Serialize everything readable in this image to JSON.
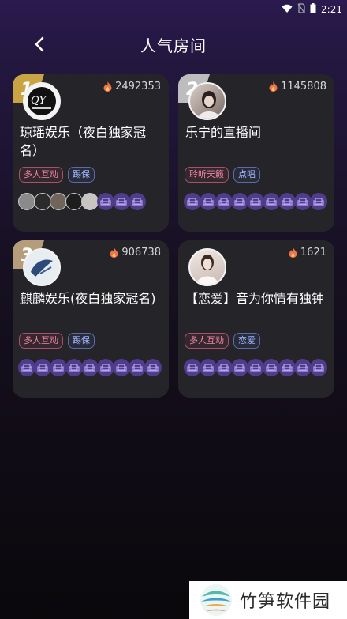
{
  "status_bar": {
    "time": "2:21"
  },
  "header": {
    "title": "人气房间"
  },
  "rooms": [
    {
      "rank": "1",
      "heat": "2492353",
      "name": "琼瑶娱乐（夜白独家冠名）",
      "tags": [
        "多人互动",
        "踢保"
      ]
    },
    {
      "rank": "2",
      "heat": "1145808",
      "name": "乐宁的直播间",
      "tags": [
        "聆听天籁",
        "点唱"
      ]
    },
    {
      "rank": "3",
      "heat": "906738",
      "name": "麒麟娱乐(夜白独家冠名)",
      "tags": [
        "多人互动",
        "踢保"
      ]
    },
    {
      "rank": "",
      "heat": "1621",
      "name": "【恋爱】音为你情有独钟",
      "tags": [
        "多人互动",
        "恋爱"
      ]
    }
  ],
  "watermark": {
    "text": "竹笋软件园"
  },
  "colors": {
    "card_bg": "#252428",
    "seat_empty": "#4f3c8a",
    "rank_gold": "#c9a445",
    "rank_silver": "#bdbdbd",
    "rank_bronze": "#b59c7a"
  }
}
